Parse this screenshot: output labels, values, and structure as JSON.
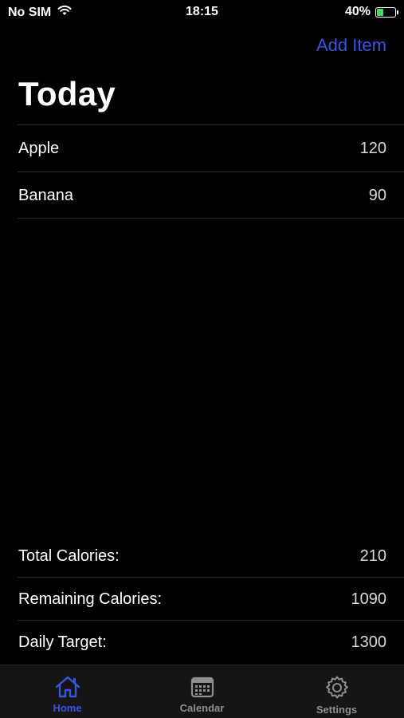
{
  "status_bar": {
    "carrier": "No SIM",
    "time": "18:15",
    "battery_percent": "40%",
    "battery_level": 0.4,
    "icons": [
      "wifi-icon",
      "battery-icon",
      "charging-bolt-icon"
    ]
  },
  "nav": {
    "add_item_label": "Add Item",
    "title": "Today"
  },
  "items": [
    {
      "name": "Apple",
      "calories": "120"
    },
    {
      "name": "Banana",
      "calories": "90"
    }
  ],
  "summary": {
    "total_label": "Total Calories:",
    "total_value": "210",
    "remaining_label": "Remaining Calories:",
    "remaining_value": "1090",
    "target_label": "Daily Target:",
    "target_value": "1300"
  },
  "tabs": [
    {
      "label": "Home",
      "icon": "home-icon",
      "active": true
    },
    {
      "label": "Calendar",
      "icon": "calendar-icon",
      "active": false
    },
    {
      "label": "Settings",
      "icon": "gear-icon",
      "active": false
    }
  ],
  "colors": {
    "accent": "#3a55e0",
    "background": "#000000",
    "tab_bar": "#151515",
    "inactive": "#8e8e93",
    "battery_fill": "#4cd964"
  }
}
